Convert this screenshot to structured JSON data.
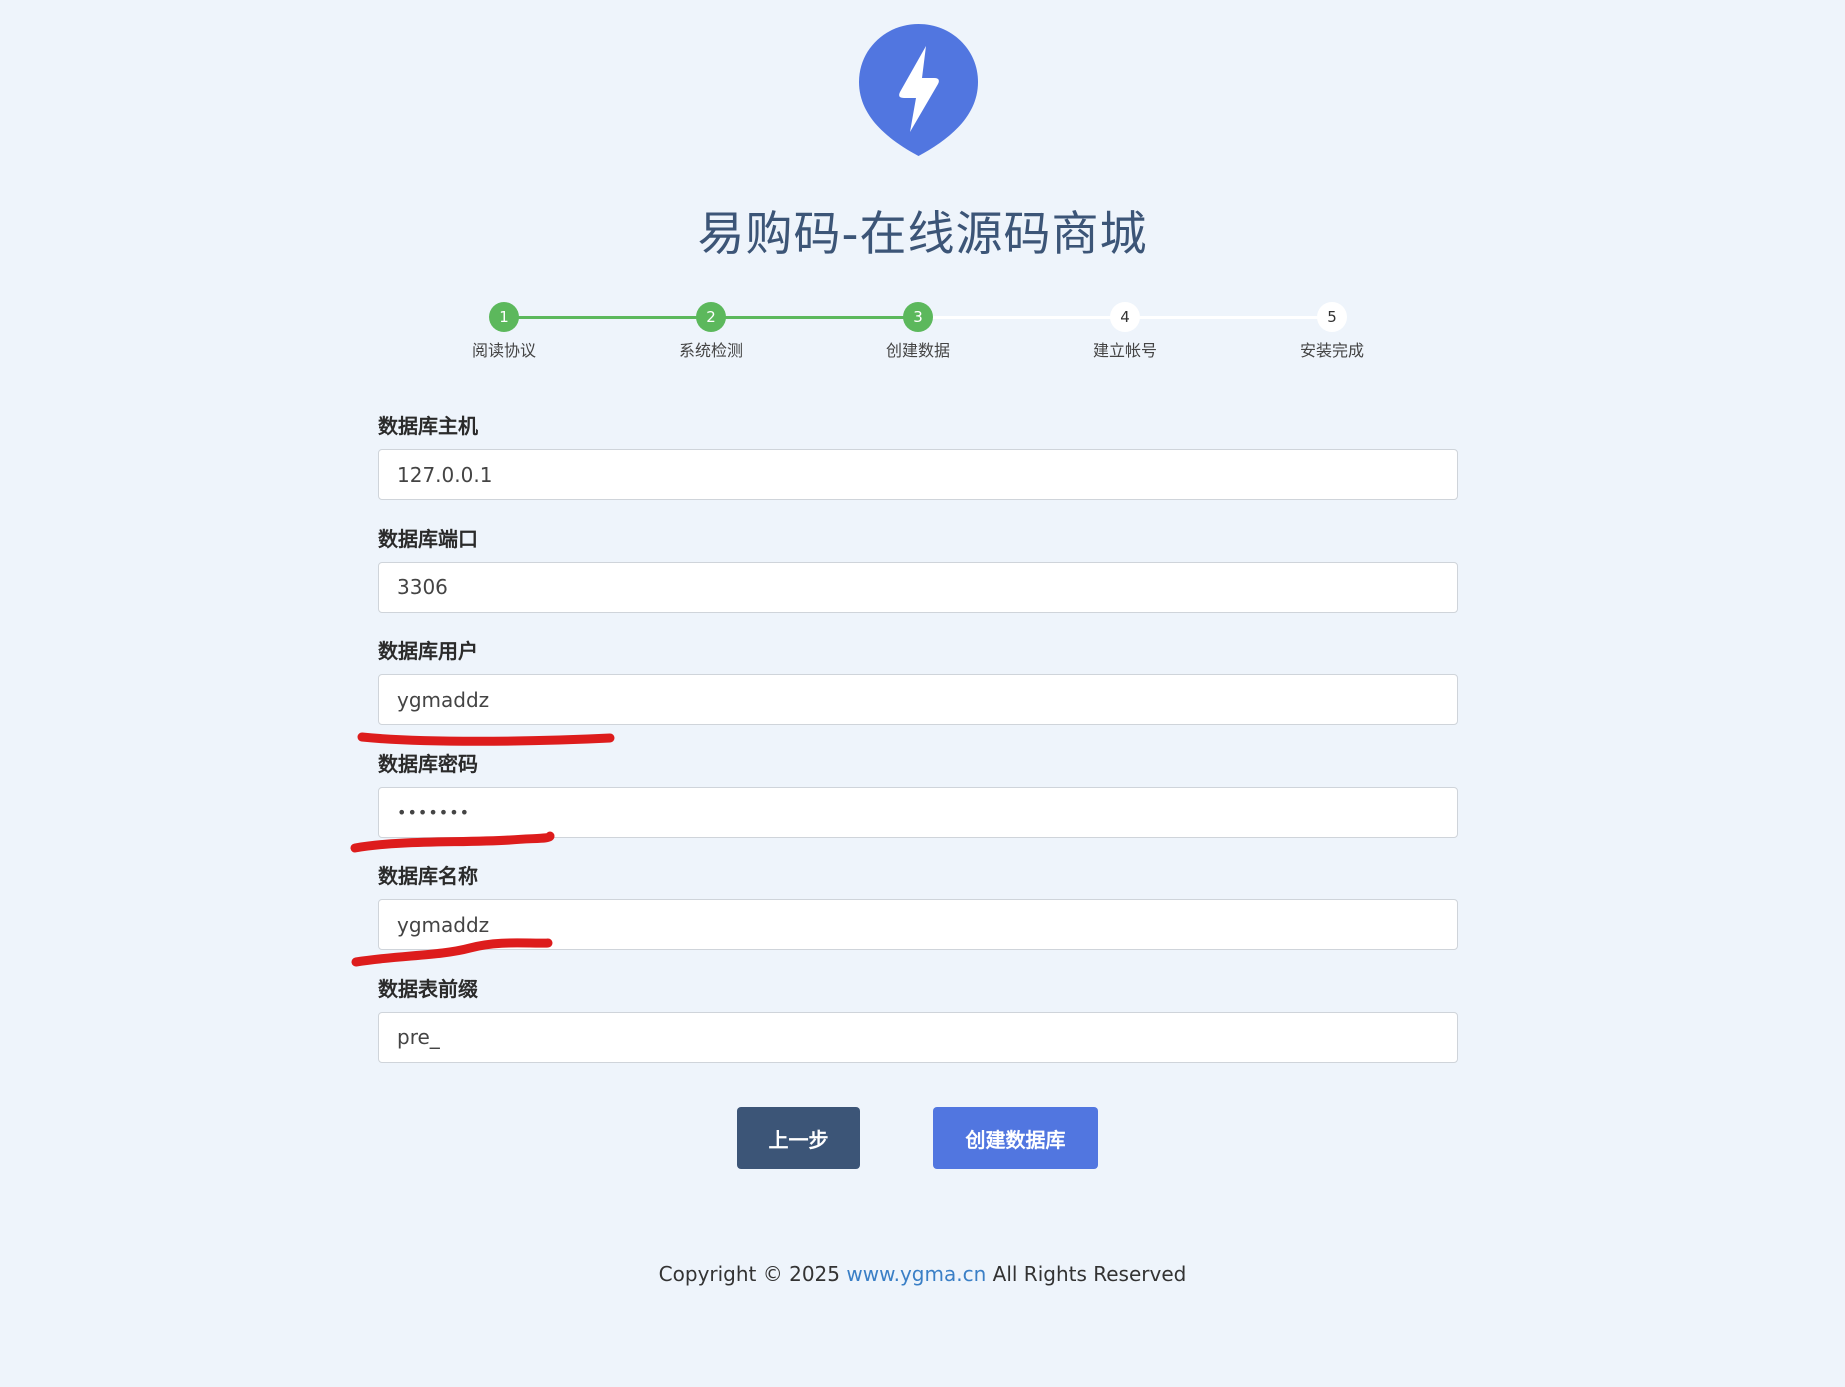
{
  "header": {
    "title": "易购码-在线源码商城",
    "logo_icon": "lightning-bolt-icon",
    "logo_color": "#5176e0"
  },
  "steps": [
    {
      "number": "1",
      "label": "阅读协议",
      "status": "done"
    },
    {
      "number": "2",
      "label": "系统检测",
      "status": "done"
    },
    {
      "number": "3",
      "label": "创建数据",
      "status": "current"
    },
    {
      "number": "4",
      "label": "建立帐号",
      "status": "todo"
    },
    {
      "number": "5",
      "label": "安装完成",
      "status": "todo"
    }
  ],
  "form": {
    "db_host": {
      "label": "数据库主机",
      "value": "127.0.0.1"
    },
    "db_port": {
      "label": "数据库端口",
      "value": "3306"
    },
    "db_user": {
      "label": "数据库用户",
      "value": "ygmaddz"
    },
    "db_password": {
      "label": "数据库密码",
      "value": "•••••••"
    },
    "db_name": {
      "label": "数据库名称",
      "value": "ygmaddz"
    },
    "table_prefix": {
      "label": "数据表前缀",
      "value": "pre_"
    }
  },
  "buttons": {
    "prev": "上一步",
    "create": "创建数据库"
  },
  "footer": {
    "prefix": "Copyright © 2025",
    "link": "www.ygma.cn",
    "suffix": "All Rights Reserved"
  },
  "colors": {
    "step_done": "#5cb85c",
    "primary_dark": "#3c5577",
    "primary_blue": "#5176e0",
    "annotation_red": "#dd1c1c"
  }
}
